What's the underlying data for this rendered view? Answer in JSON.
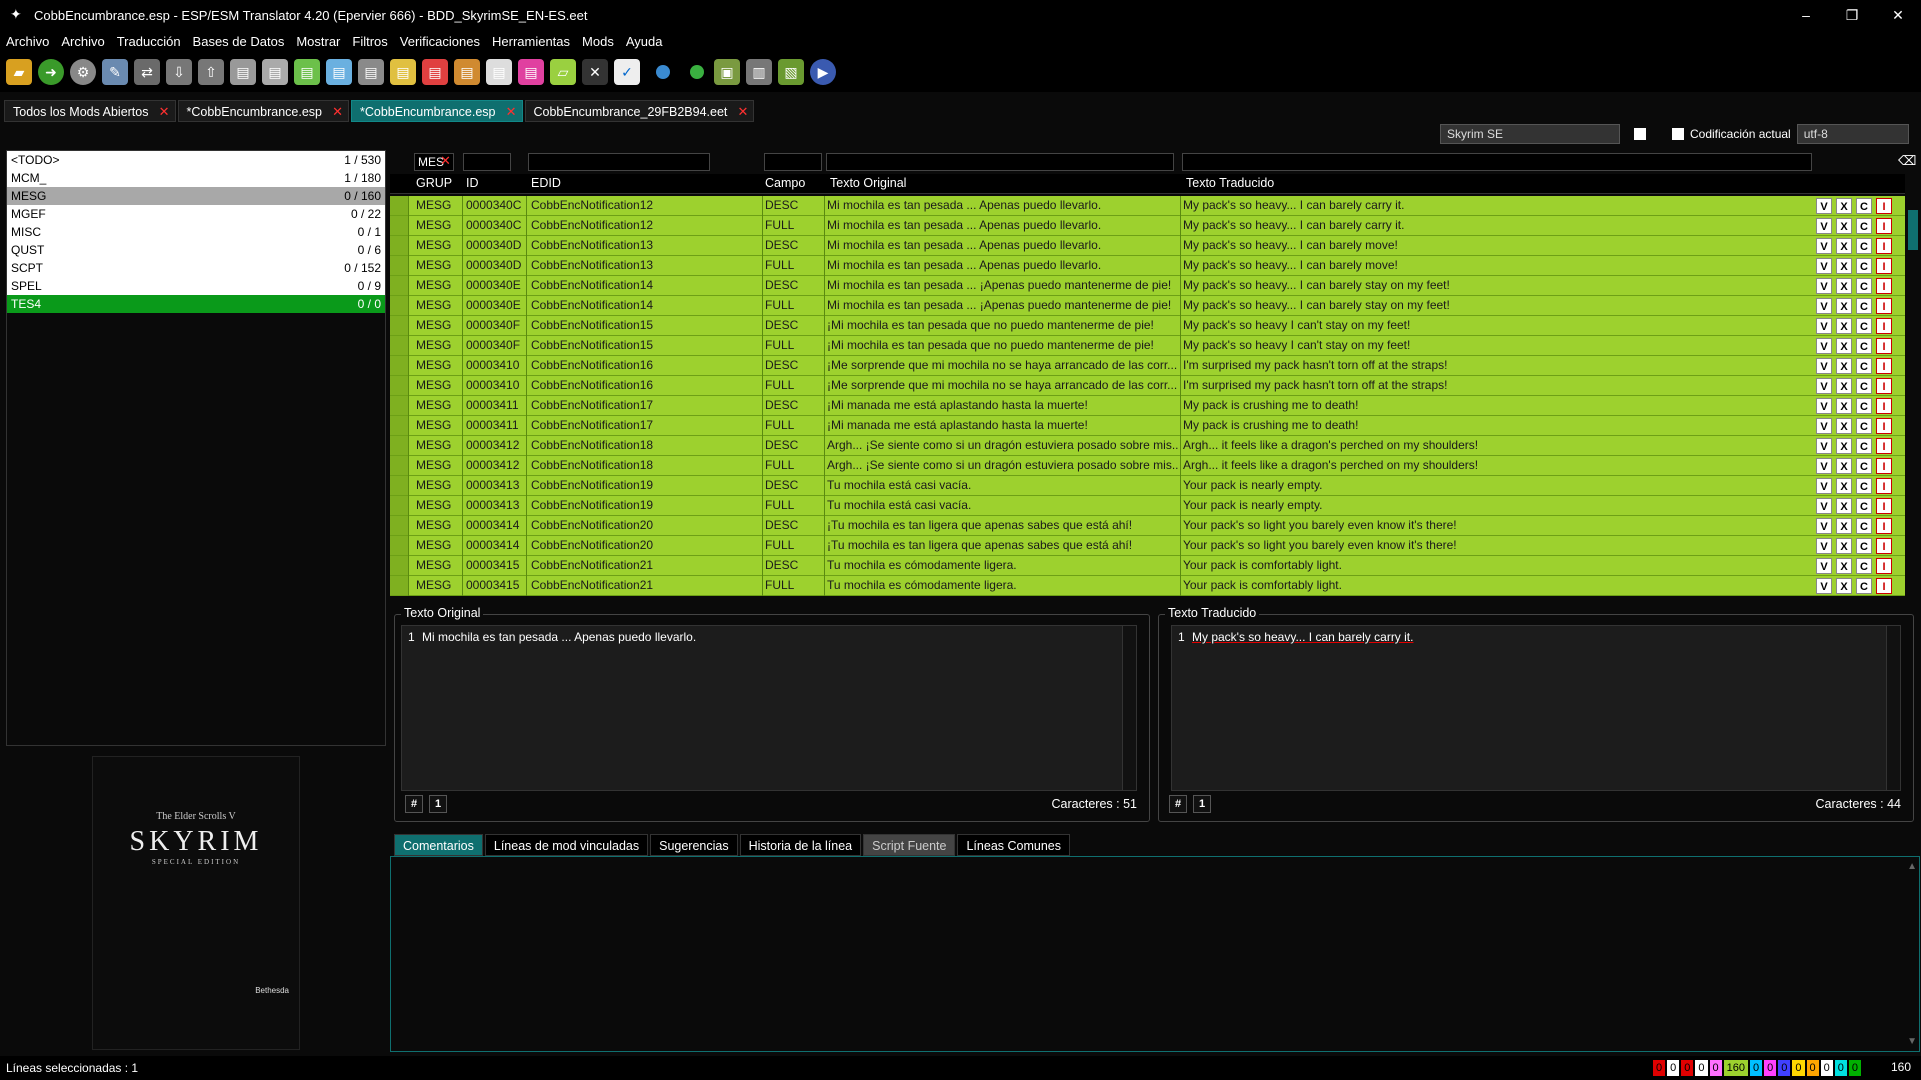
{
  "window": {
    "title": "CobbEncumbrance.esp - ESP/ESM Translator 4.20 (Epervier 666) - BDD_SkyrimSE_EN-ES.eet",
    "minimize": "–",
    "restore": "❐",
    "close": "✕"
  },
  "menu": [
    "Archivo",
    "Archivo",
    "Traducción",
    "Bases de Datos",
    "Mostrar",
    "Filtros",
    "Verificaciones",
    "Herramientas",
    "Mods",
    "Ayuda"
  ],
  "tabs": [
    {
      "label": "Todos los Mods Abiertos",
      "active": false
    },
    {
      "label": "*CobbEncumbrance.esp",
      "active": false
    },
    {
      "label": "*CobbEncumbrance.esp",
      "active": true
    },
    {
      "label": "CobbEncumbrance_29FB2B94.eet",
      "active": false
    }
  ],
  "options": {
    "game": "Skyrim SE",
    "encoding_label": "Codificación actual",
    "encoding": "utf-8"
  },
  "left_list": [
    {
      "name": "<TODO>",
      "count": "1 / 530",
      "style": "white"
    },
    {
      "name": "MCM_",
      "count": "1 / 180",
      "style": "white"
    },
    {
      "name": "MESG",
      "count": "0 / 160",
      "style": "gray"
    },
    {
      "name": "MGEF",
      "count": "0 / 22",
      "style": "white"
    },
    {
      "name": "MISC",
      "count": "0 / 1",
      "style": "white"
    },
    {
      "name": "QUST",
      "count": "0 / 6",
      "style": "white"
    },
    {
      "name": "SCPT",
      "count": "0 / 152",
      "style": "white"
    },
    {
      "name": "SPEL",
      "count": "0 / 9",
      "style": "white"
    },
    {
      "name": "TES4",
      "count": "0 / 0",
      "style": "green"
    }
  ],
  "cover": {
    "subtitle": "The Elder Scrolls V",
    "title": "SKYRIM",
    "edition": "SPECIAL EDITION",
    "publisher": "Bethesda"
  },
  "filters": {
    "grup": "MES"
  },
  "columns": [
    "GRUP",
    "ID",
    "EDID",
    "Campo",
    "Texto Original",
    "Texto Traducido"
  ],
  "row_buttons": [
    "V",
    "X",
    "C",
    "I"
  ],
  "rows": [
    {
      "grup": "MESG",
      "id": "0000340C",
      "edid": "CobbEncNotification12",
      "campo": "DESC",
      "orig": "Mi mochila es tan pesada ... Apenas puedo llevarlo.",
      "trad": "My pack's so heavy... I can barely carry it."
    },
    {
      "grup": "MESG",
      "id": "0000340C",
      "edid": "CobbEncNotification12",
      "campo": "FULL",
      "orig": "Mi mochila es tan pesada ... Apenas puedo llevarlo.",
      "trad": "My pack's so heavy... I can barely carry it."
    },
    {
      "grup": "MESG",
      "id": "0000340D",
      "edid": "CobbEncNotification13",
      "campo": "DESC",
      "orig": "Mi mochila es tan pesada ... Apenas puedo llevarlo.",
      "trad": "My pack's so heavy... I can barely move!"
    },
    {
      "grup": "MESG",
      "id": "0000340D",
      "edid": "CobbEncNotification13",
      "campo": "FULL",
      "orig": "Mi mochila es tan pesada ... Apenas puedo llevarlo.",
      "trad": "My pack's so heavy... I can barely move!"
    },
    {
      "grup": "MESG",
      "id": "0000340E",
      "edid": "CobbEncNotification14",
      "campo": "DESC",
      "orig": "Mi mochila es tan pesada ... ¡Apenas puedo mantenerme de pie!",
      "trad": "My pack's so heavy... I can barely stay on my feet!"
    },
    {
      "grup": "MESG",
      "id": "0000340E",
      "edid": "CobbEncNotification14",
      "campo": "FULL",
      "orig": "Mi mochila es tan pesada ... ¡Apenas puedo mantenerme de pie!",
      "trad": "My pack's so heavy... I can barely stay on my feet!"
    },
    {
      "grup": "MESG",
      "id": "0000340F",
      "edid": "CobbEncNotification15",
      "campo": "DESC",
      "orig": "¡Mi mochila es tan pesada que no puedo mantenerme de pie!",
      "trad": "My pack's so heavy I can't stay on my feet!"
    },
    {
      "grup": "MESG",
      "id": "0000340F",
      "edid": "CobbEncNotification15",
      "campo": "FULL",
      "orig": "¡Mi mochila es tan pesada que no puedo mantenerme de pie!",
      "trad": "My pack's so heavy I can't stay on my feet!"
    },
    {
      "grup": "MESG",
      "id": "00003410",
      "edid": "CobbEncNotification16",
      "campo": "DESC",
      "orig": "¡Me sorprende que mi mochila no se haya arrancado de las corr...",
      "trad": "I'm surprised my pack hasn't torn off at the straps!"
    },
    {
      "grup": "MESG",
      "id": "00003410",
      "edid": "CobbEncNotification16",
      "campo": "FULL",
      "orig": "¡Me sorprende que mi mochila no se haya arrancado de las corr...",
      "trad": "I'm surprised my pack hasn't torn off at the straps!"
    },
    {
      "grup": "MESG",
      "id": "00003411",
      "edid": "CobbEncNotification17",
      "campo": "DESC",
      "orig": "¡Mi manada me está aplastando hasta la muerte!",
      "trad": "My pack is crushing me to death!"
    },
    {
      "grup": "MESG",
      "id": "00003411",
      "edid": "CobbEncNotification17",
      "campo": "FULL",
      "orig": "¡Mi manada me está aplastando hasta la muerte!",
      "trad": "My pack is crushing me to death!"
    },
    {
      "grup": "MESG",
      "id": "00003412",
      "edid": "CobbEncNotification18",
      "campo": "DESC",
      "orig": "Argh... ¡Se siente como si un dragón estuviera posado sobre mis...",
      "trad": "Argh... it feels like a dragon's perched on my shoulders!"
    },
    {
      "grup": "MESG",
      "id": "00003412",
      "edid": "CobbEncNotification18",
      "campo": "FULL",
      "orig": "Argh... ¡Se siente como si un dragón estuviera posado sobre mis...",
      "trad": "Argh... it feels like a dragon's perched on my shoulders!"
    },
    {
      "grup": "MESG",
      "id": "00003413",
      "edid": "CobbEncNotification19",
      "campo": "DESC",
      "orig": "Tu mochila está casi vacía.",
      "trad": "Your pack is nearly empty."
    },
    {
      "grup": "MESG",
      "id": "00003413",
      "edid": "CobbEncNotification19",
      "campo": "FULL",
      "orig": "Tu mochila está casi vacía.",
      "trad": "Your pack is nearly empty."
    },
    {
      "grup": "MESG",
      "id": "00003414",
      "edid": "CobbEncNotification20",
      "campo": "DESC",
      "orig": "¡Tu mochila es tan ligera que apenas sabes que está ahí!",
      "trad": "Your pack's so light you barely even know it's there!"
    },
    {
      "grup": "MESG",
      "id": "00003414",
      "edid": "CobbEncNotification20",
      "campo": "FULL",
      "orig": "¡Tu mochila es tan ligera que apenas sabes que está ahí!",
      "trad": "Your pack's so light you barely even know it's there!"
    },
    {
      "grup": "MESG",
      "id": "00003415",
      "edid": "CobbEncNotification21",
      "campo": "DESC",
      "orig": "Tu mochila es cómodamente ligera.",
      "trad": "Your pack is comfortably light."
    },
    {
      "grup": "MESG",
      "id": "00003415",
      "edid": "CobbEncNotification21",
      "campo": "FULL",
      "orig": "Tu mochila es cómodamente ligera.",
      "trad": "Your pack is comfortably light."
    }
  ],
  "original_panel": {
    "label": "Texto Original",
    "line_number": "1",
    "text": "Mi mochila es tan pesada ... Apenas puedo llevarlo.",
    "hash": "#",
    "one": "1",
    "chars": "Caracteres : 51"
  },
  "translated_panel": {
    "label": "Texto Traducido",
    "line_number": "1",
    "text": "My pack's so heavy... I can barely carry it.",
    "hash": "#",
    "one": "1",
    "chars": "Caracteres : 44"
  },
  "bottom_tabs": [
    {
      "label": "Comentarios",
      "state": "active"
    },
    {
      "label": "Líneas de mod vinculadas",
      "state": "normal"
    },
    {
      "label": "Sugerencias",
      "state": "normal"
    },
    {
      "label": "Historia de la línea",
      "state": "normal"
    },
    {
      "label": "Script Fuente",
      "state": "muted"
    },
    {
      "label": "Líneas Comunes",
      "state": "normal"
    }
  ],
  "status": {
    "selected": "Líneas seleccionadas : 1",
    "counters": [
      {
        "v": "0",
        "c": "#e00000"
      },
      {
        "v": "0",
        "c": "#ffffff"
      },
      {
        "v": "0",
        "c": "#e00000"
      },
      {
        "v": "0",
        "c": "#ffffff"
      },
      {
        "v": "0",
        "c": "#ff70ff"
      },
      {
        "v": "160",
        "c": "#9dd12e"
      },
      {
        "v": "0",
        "c": "#00c0ff"
      },
      {
        "v": "0",
        "c": "#ff40ff"
      },
      {
        "v": "0",
        "c": "#4040ff"
      },
      {
        "v": "0",
        "c": "#ffd700"
      },
      {
        "v": "0",
        "c": "#ffa500"
      },
      {
        "v": "0",
        "c": "#ffffff"
      },
      {
        "v": "0",
        "c": "#00e0e0"
      },
      {
        "v": "0",
        "c": "#00b000"
      }
    ],
    "total": "160"
  },
  "colors": {
    "accent": "#0f6f6f",
    "row_green": "#9dd12e",
    "selected_green": "#0a9a1a"
  }
}
